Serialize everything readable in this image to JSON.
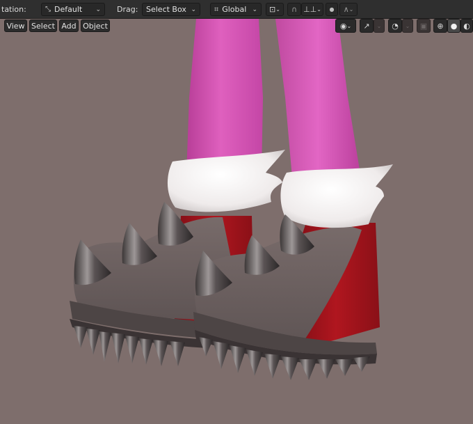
{
  "header": {
    "orientation_label": "tation:",
    "orientation_value": "Default",
    "drag_label": "Drag:",
    "drag_value": "Select Box",
    "transform_value": "Global"
  },
  "menu": {
    "items": [
      "View",
      "Select",
      "Add",
      "Object"
    ]
  },
  "icons": {
    "orientation": "orientation-gizmo-icon",
    "transform": "transform-orientation-icon",
    "pivot": "pivot-point-icon",
    "snap": "snap-magnet-icon",
    "snap_target": "snap-increment-icon",
    "proportional": "proportional-edit-icon",
    "falloff": "falloff-curve-icon",
    "visibility": "eye-visibility-icon",
    "gizmo": "gizmo-icon",
    "overlay": "overlay-icon",
    "xray": "xray-icon",
    "wireframe": "wireframe-shading-icon",
    "solid": "solid-shading-icon",
    "material": "material-shading-icon"
  },
  "colors": {
    "viewport_bg": "#7e6e6c",
    "leg": "#d552b4",
    "fur": "#f2f0f0",
    "boot_gray": "#6b5f5e",
    "boot_red": "#a3141c",
    "spike": "#575051"
  }
}
